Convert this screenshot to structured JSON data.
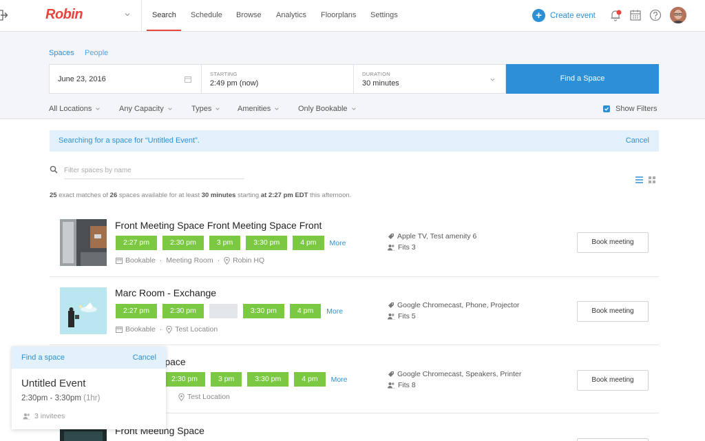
{
  "brand": {
    "name": "Robin",
    "accent": "#e8453c",
    "primary": "#2d8fd5",
    "slot_color": "#7bc943"
  },
  "nav": {
    "tabs": [
      "Search",
      "Schedule",
      "Browse",
      "Analytics",
      "Floorplans",
      "Settings"
    ],
    "active": "Search",
    "create_event": "Create event"
  },
  "search": {
    "subtabs": [
      "Spaces",
      "People"
    ],
    "date": "June 23, 2016",
    "starting_label": "STARTING",
    "starting_value": "2:49 pm (now)",
    "duration_label": "DURATION",
    "duration_value": "30 minutes",
    "find_button": "Find a Space",
    "filters": [
      "All Locations",
      "Any Capacity",
      "Types",
      "Amenities",
      "Only Bookable"
    ],
    "show_filters": "Show Filters",
    "show_filters_checked": true
  },
  "banner": {
    "text": "Searching for a space for “Untitled Event”.",
    "cancel": "Cancel"
  },
  "filter_input": {
    "placeholder": "Filter spaces by name",
    "value": ""
  },
  "summary": {
    "count": "25",
    "t1": " exact matches of ",
    "total": "26",
    "t2": " spaces available for at least ",
    "duration": "30 minutes",
    "t3": " starting ",
    "start": "at 2:27 pm EDT",
    "t4": " this afternoon."
  },
  "results": [
    {
      "title": "Front Meeting Space Front Meeting Space Front",
      "slots": [
        "2:27 pm",
        "2:30 pm",
        "3 pm",
        "3:30 pm",
        "4 pm"
      ],
      "more": "More",
      "bookable": "Bookable",
      "type": "Meeting Room",
      "location": "Robin HQ",
      "amenities": "Apple TV, Test amenity 6",
      "fits": "Fits 3",
      "book": "Book meeting"
    },
    {
      "title": "Marc Room - Exchange",
      "slots": [
        "2:27 pm",
        "2:30 pm",
        "",
        "3:30 pm",
        "4 pm"
      ],
      "more": "More",
      "bookable": "Bookable",
      "location": "Test Location",
      "amenities": "Google Chromecast, Phone, Projector",
      "fits": "Fits 5",
      "book": "Book meeting"
    },
    {
      "title": "Space",
      "slots": [
        "2:30 pm",
        "3 pm",
        "3:30 pm",
        "4 pm"
      ],
      "more": "More",
      "location": "Test Location",
      "amenities": "Google Chromecast, Speakers, Printer",
      "fits": "Fits 8",
      "book": "Book meeting"
    },
    {
      "title": "Front Meeting Space"
    }
  ],
  "panel": {
    "find": "Find a space",
    "cancel": "Cancel",
    "title": "Untitled Event",
    "time": "2:30pm - 3:30pm",
    "duration": "(1hr)",
    "invitees": "3 invitees"
  }
}
